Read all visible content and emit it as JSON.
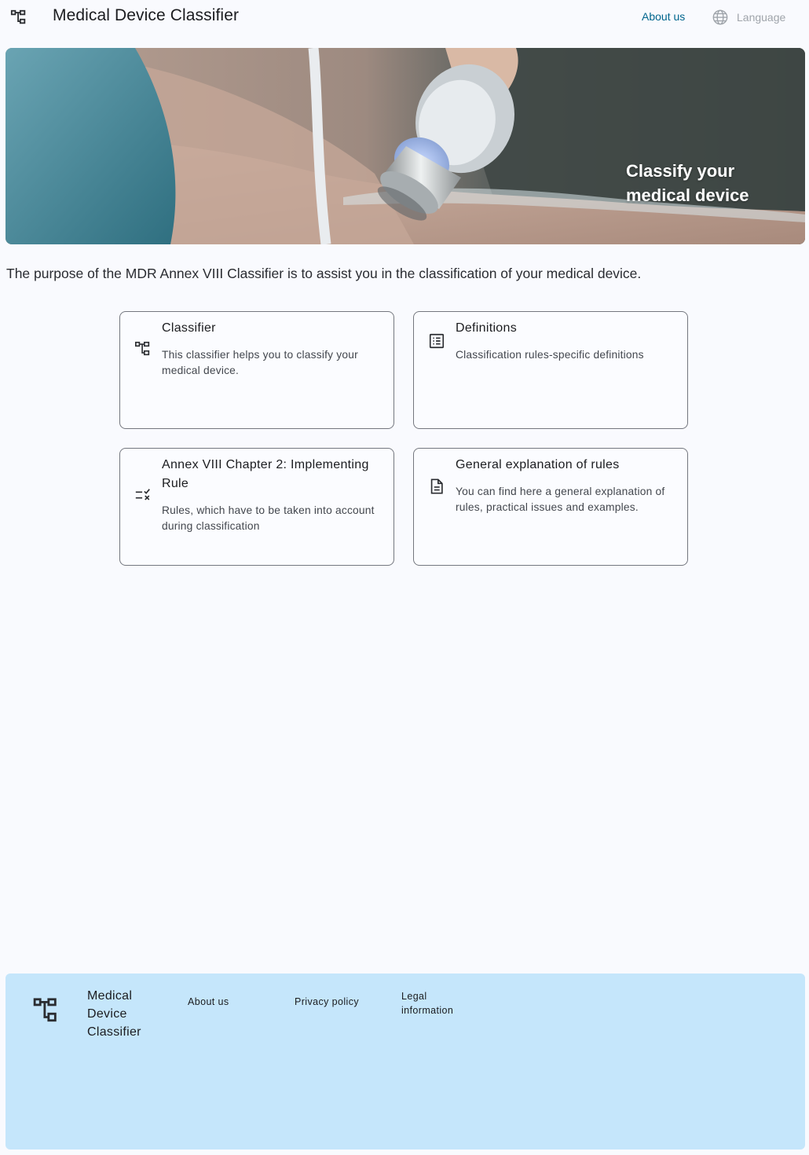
{
  "header": {
    "app_title": "Medical Device Classifier",
    "about_label": "About us",
    "language_label": "Language",
    "logo_icon": "account-tree-icon",
    "language_icon": "globe-icon"
  },
  "hero": {
    "headline_line1": "Classify your",
    "headline_line2": "medical device"
  },
  "intro_text": "The purpose of the MDR Annex VIII Classifier is to assist you in the classification of your medical device.",
  "cards": [
    {
      "icon": "account-tree-icon",
      "title": "Classifier",
      "description": "This classifier helps you to classify your medical device."
    },
    {
      "icon": "list-icon",
      "title": "Definitions",
      "description": "Classification rules-specific definitions"
    },
    {
      "icon": "rule-icon",
      "title": "Annex VIII Chapter 2: Implementing Rule",
      "description": "Rules, which have to be taken into account during classification"
    },
    {
      "icon": "document-icon",
      "title": "General explanation of rules",
      "description": "You can find here a general explanation of rules, practical issues and examples."
    }
  ],
  "footer": {
    "title": "Medical Device Classifier",
    "links": [
      "About us",
      "Privacy policy",
      "Legal information"
    ]
  },
  "colors": {
    "accent": "#00658d",
    "footer_bg": "#c5e6fb",
    "page_bg": "#f9fafe"
  }
}
